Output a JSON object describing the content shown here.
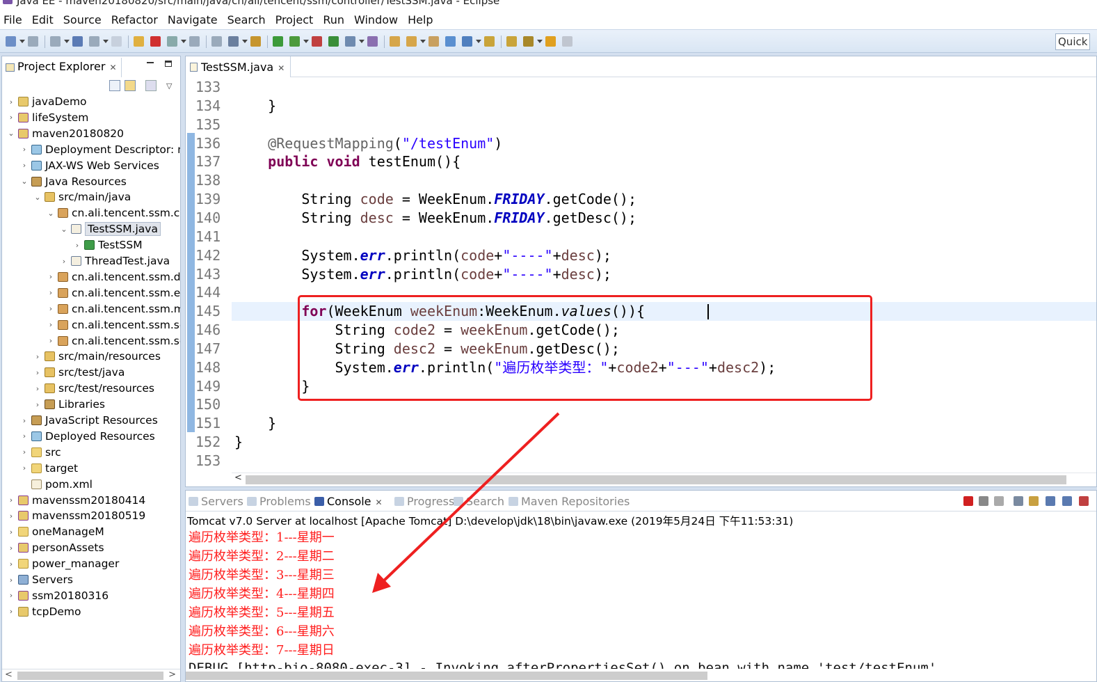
{
  "window": {
    "title": "Java EE - maven20180820/src/main/java/cn/ali/tencent/ssm/controller/TestSSM.java - Eclipse"
  },
  "menu": [
    "File",
    "Edit",
    "Source",
    "Refactor",
    "Navigate",
    "Search",
    "Project",
    "Run",
    "Window",
    "Help"
  ],
  "toolbar": {
    "quick_access": "Quick"
  },
  "project_explorer": {
    "title": "Project Explorer",
    "tree": [
      {
        "label": "javaDemo",
        "depth": 0,
        "chev": ">",
        "icon": "proj"
      },
      {
        "label": "lifeSystem",
        "depth": 0,
        "chev": ">",
        "icon": "mproj"
      },
      {
        "label": "maven20180820",
        "depth": 0,
        "chev": "v",
        "icon": "mproj"
      },
      {
        "label": "Deployment Descriptor: m",
        "depth": 1,
        "chev": ">",
        "icon": "web"
      },
      {
        "label": "JAX-WS Web Services",
        "depth": 1,
        "chev": ">",
        "icon": "web"
      },
      {
        "label": "Java Resources",
        "depth": 1,
        "chev": "v",
        "icon": "lib"
      },
      {
        "label": "src/main/java",
        "depth": 2,
        "chev": "v",
        "icon": "src"
      },
      {
        "label": "cn.ali.tencent.ssm.cor",
        "depth": 3,
        "chev": "v",
        "icon": "pkg"
      },
      {
        "label": "TestSSM.java",
        "depth": 4,
        "chev": "v",
        "icon": "java",
        "selected": true
      },
      {
        "label": "TestSSM",
        "depth": 5,
        "chev": ">",
        "icon": "class"
      },
      {
        "label": "ThreadTest.java",
        "depth": 4,
        "chev": ">",
        "icon": "java"
      },
      {
        "label": "cn.ali.tencent.ssm.doı",
        "depth": 3,
        "chev": ">",
        "icon": "pkg"
      },
      {
        "label": "cn.ali.tencent.ssm.enı",
        "depth": 3,
        "chev": ">",
        "icon": "pkg"
      },
      {
        "label": "cn.ali.tencent.ssm.ma",
        "depth": 3,
        "chev": ">",
        "icon": "pkg"
      },
      {
        "label": "cn.ali.tencent.ssm.ser",
        "depth": 3,
        "chev": ">",
        "icon": "pkg"
      },
      {
        "label": "cn.ali.tencent.ssm.ser",
        "depth": 3,
        "chev": ">",
        "icon": "pkg"
      },
      {
        "label": "src/main/resources",
        "depth": 2,
        "chev": ">",
        "icon": "src"
      },
      {
        "label": "src/test/java",
        "depth": 2,
        "chev": ">",
        "icon": "src"
      },
      {
        "label": "src/test/resources",
        "depth": 2,
        "chev": ">",
        "icon": "src"
      },
      {
        "label": "Libraries",
        "depth": 2,
        "chev": ">",
        "icon": "lib"
      },
      {
        "label": "JavaScript Resources",
        "depth": 1,
        "chev": ">",
        "icon": "lib"
      },
      {
        "label": "Deployed Resources",
        "depth": 1,
        "chev": ">",
        "icon": "web"
      },
      {
        "label": "src",
        "depth": 1,
        "chev": ">",
        "icon": "folder"
      },
      {
        "label": "target",
        "depth": 1,
        "chev": ">",
        "icon": "folder"
      },
      {
        "label": "pom.xml",
        "depth": 1,
        "chev": "",
        "icon": "xml"
      },
      {
        "label": "mavenssm20180414",
        "depth": 0,
        "chev": ">",
        "icon": "mproj"
      },
      {
        "label": "mavenssm20180519",
        "depth": 0,
        "chev": ">",
        "icon": "mproj"
      },
      {
        "label": "oneManageM",
        "depth": 0,
        "chev": ">",
        "icon": "folder"
      },
      {
        "label": "personAssets",
        "depth": 0,
        "chev": ">",
        "icon": "mproj"
      },
      {
        "label": "power_manager",
        "depth": 0,
        "chev": ">",
        "icon": "folder"
      },
      {
        "label": "Servers",
        "depth": 0,
        "chev": ">",
        "icon": "srv"
      },
      {
        "label": "ssm20180316",
        "depth": 0,
        "chev": ">",
        "icon": "mproj"
      },
      {
        "label": "tcpDemo",
        "depth": 0,
        "chev": ">",
        "icon": "proj"
      }
    ]
  },
  "editor": {
    "tab": "TestSSM.java",
    "lines": [
      {
        "n": "133",
        "code": []
      },
      {
        "n": "134",
        "code": [
          [
            "    }",
            ""
          ]
        ]
      },
      {
        "n": "135",
        "code": []
      },
      {
        "n": "136",
        "code": [
          [
            "    ",
            ""
          ],
          [
            "@RequestMapping",
            "an"
          ],
          [
            "(",
            ""
          ],
          [
            "\"/testEnum\"",
            "st"
          ],
          [
            ")",
            ""
          ]
        ]
      },
      {
        "n": "137",
        "code": [
          [
            "    ",
            ""
          ],
          [
            "public",
            "kw"
          ],
          [
            " ",
            ""
          ],
          [
            "void",
            "kw"
          ],
          [
            " testEnum(){",
            ""
          ]
        ]
      },
      {
        "n": "138",
        "code": []
      },
      {
        "n": "139",
        "code": [
          [
            "        String ",
            ""
          ],
          [
            "code",
            "lv"
          ],
          [
            " = WeekEnum.",
            ""
          ],
          [
            "FRIDAY",
            "fs"
          ],
          [
            ".getCode();",
            ""
          ]
        ]
      },
      {
        "n": "140",
        "code": [
          [
            "        String ",
            ""
          ],
          [
            "desc",
            "lv"
          ],
          [
            " = WeekEnum.",
            ""
          ],
          [
            "FRIDAY",
            "fs"
          ],
          [
            ".getDesc();",
            ""
          ]
        ]
      },
      {
        "n": "141",
        "code": []
      },
      {
        "n": "142",
        "code": [
          [
            "        System.",
            ""
          ],
          [
            "err",
            "fs"
          ],
          [
            ".println(",
            ""
          ],
          [
            "code",
            "lv"
          ],
          [
            "+",
            ""
          ],
          [
            "\"----\"",
            "st"
          ],
          [
            "+",
            ""
          ],
          [
            "desc",
            "lv"
          ],
          [
            ");",
            ""
          ]
        ]
      },
      {
        "n": "143",
        "code": [
          [
            "        System.",
            ""
          ],
          [
            "err",
            "fs"
          ],
          [
            ".println(",
            ""
          ],
          [
            "code",
            "lv"
          ],
          [
            "+",
            ""
          ],
          [
            "\"----\"",
            "st"
          ],
          [
            "+",
            ""
          ],
          [
            "desc",
            "lv"
          ],
          [
            ");",
            ""
          ]
        ]
      },
      {
        "n": "144",
        "code": []
      },
      {
        "n": "145",
        "code": [
          [
            "        ",
            ""
          ],
          [
            "for",
            "kw"
          ],
          [
            "(WeekEnum ",
            ""
          ],
          [
            "weekEnum",
            "lv"
          ],
          [
            ":WeekEnum.",
            ""
          ],
          [
            "values",
            "mi-it"
          ],
          [
            "()){",
            ""
          ]
        ],
        "current": true
      },
      {
        "n": "146",
        "code": [
          [
            "            String ",
            ""
          ],
          [
            "code2",
            "lv"
          ],
          [
            " = ",
            ""
          ],
          [
            "weekEnum",
            "lv"
          ],
          [
            ".getCode();",
            ""
          ]
        ]
      },
      {
        "n": "147",
        "code": [
          [
            "            String ",
            ""
          ],
          [
            "desc2",
            "lv"
          ],
          [
            " = ",
            ""
          ],
          [
            "weekEnum",
            "lv"
          ],
          [
            ".getDesc();",
            ""
          ]
        ]
      },
      {
        "n": "148",
        "code": [
          [
            "            System.",
            ""
          ],
          [
            "err",
            "fs"
          ],
          [
            ".println(",
            ""
          ],
          [
            "\"遍历枚举类型：\"",
            "st"
          ],
          [
            "+",
            ""
          ],
          [
            "code2",
            "lv"
          ],
          [
            "+",
            ""
          ],
          [
            "\"---\"",
            "st"
          ],
          [
            "+",
            ""
          ],
          [
            "desc2",
            "lv"
          ],
          [
            ");",
            ""
          ]
        ]
      },
      {
        "n": "149",
        "code": [
          [
            "        }",
            ""
          ]
        ]
      },
      {
        "n": "150",
        "code": []
      },
      {
        "n": "151",
        "code": [
          [
            "    }",
            ""
          ]
        ]
      },
      {
        "n": "152",
        "code": [
          [
            "}",
            ""
          ]
        ]
      },
      {
        "n": "153",
        "code": []
      }
    ]
  },
  "console": {
    "tabs": [
      "Servers",
      "Problems",
      "Console",
      "Progress",
      "Search",
      "Maven Repositories"
    ],
    "active_tab": "Console",
    "description": "Tomcat v7.0 Server at localhost [Apache Tomcat] D:\\develop\\jdk\\18\\bin\\javaw.exe (2019年5月24日 下午11:53:31)",
    "lines": [
      "遍历枚举类型：1---星期一",
      "遍历枚举类型：2---星期二",
      "遍历枚举类型：3---星期三",
      "遍历枚举类型：4---星期四",
      "遍历枚举类型：5---星期五",
      "遍历枚举类型：6---星期六",
      "遍历枚举类型：7---星期日"
    ],
    "debug_line": "DEBUG [http-bio-8080-exec-3] - Invoking afterPropertiesSet() on bean with name 'test/testEnum'"
  }
}
